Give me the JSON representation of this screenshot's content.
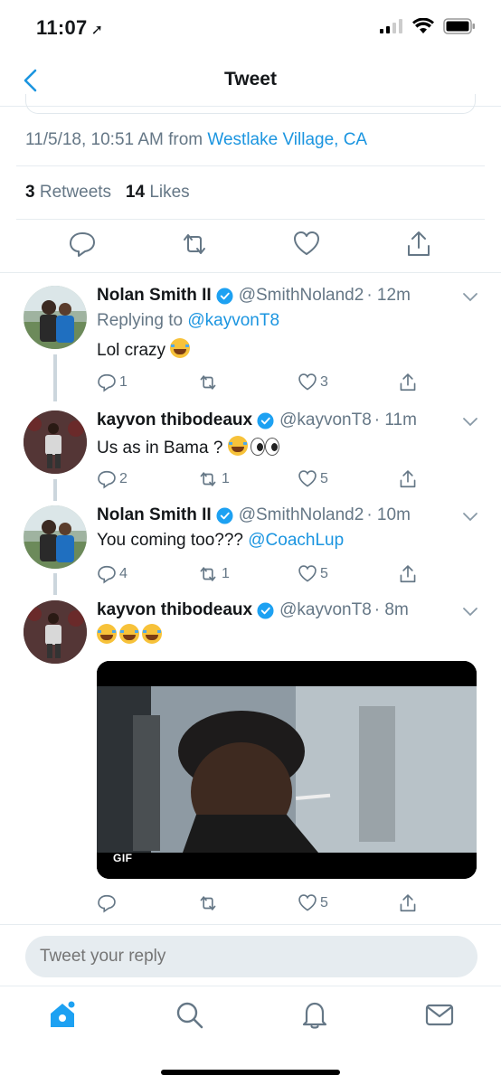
{
  "status_bar": {
    "time": "11:07"
  },
  "nav": {
    "title": "Tweet"
  },
  "main_tweet": {
    "timestamp": "11/5/18, 10:51 AM from",
    "location": "Westlake Village, CA",
    "retweets_count": "3",
    "retweets_label": "Retweets",
    "likes_count": "14",
    "likes_label": "Likes"
  },
  "replies": [
    {
      "name": "Nolan Smith II",
      "handle": "@SmithNoland2",
      "time": "· 12m",
      "replying_prefix": "Replying to",
      "replying_to": "@kayvonT8",
      "text": "Lol crazy",
      "reply_count": "1",
      "retweet_count": "",
      "like_count": "3"
    },
    {
      "name": "kayvon thibodeaux",
      "handle": "@kayvonT8",
      "time": "· 11m",
      "text": "Us as in Bama ?",
      "reply_count": "2",
      "retweet_count": "1",
      "like_count": "5"
    },
    {
      "name": "Nolan Smith II",
      "handle": "@SmithNoland2",
      "time": "· 10m",
      "text": "You coming too???",
      "mention": "@CoachLup",
      "reply_count": "4",
      "retweet_count": "1",
      "like_count": "5"
    },
    {
      "name": "kayvon thibodeaux",
      "handle": "@kayvonT8",
      "time": "· 8m",
      "text": "",
      "gif_label": "GIF",
      "reply_count": "",
      "retweet_count": "",
      "like_count": "5"
    }
  ],
  "reply_box": {
    "placeholder": "Tweet your reply"
  },
  "colors": {
    "accent": "#1b95e0",
    "muted": "#657786",
    "divider": "#e6ecf0"
  },
  "icons": [
    "back-chevron-icon",
    "reply-icon",
    "retweet-icon",
    "like-icon",
    "share-icon",
    "verified-icon",
    "chevron-down-icon",
    "home-icon",
    "search-icon",
    "notifications-icon",
    "messages-icon"
  ]
}
